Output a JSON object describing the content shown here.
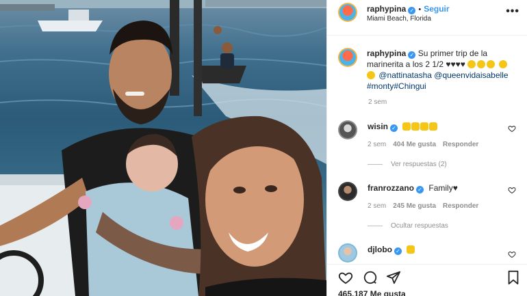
{
  "post": {
    "author": "raphypina",
    "follow_label": "Seguir",
    "location": "Miami Beach, Florida",
    "more_label": "•••"
  },
  "caption": {
    "author": "raphypina",
    "text_1": "Su primer trip de la marinerita a los 2 1/2",
    "hearts": "♥♥♥♥",
    "mention_1": "@nattinatasha",
    "mention_2": "@queenvidaisabelle",
    "hashtag_1": "#monty",
    "hashtag_2": "#Chingui",
    "time": "2 sem"
  },
  "comments": [
    {
      "user": "wisin",
      "time": "2 sem",
      "likes": "404 Me gusta",
      "reply": "Responder",
      "replies_label": "Ver respuestas (2)"
    },
    {
      "user": "franrozzano",
      "text": "Family♥",
      "time": "2 sem",
      "likes": "245 Me gusta",
      "reply": "Responder",
      "replies_label": "Ocultar respuestas"
    },
    {
      "user": "djlobo"
    }
  ],
  "footer": {
    "likes_count": "465.187 Me gusta"
  },
  "icons": {
    "like": "heart-outline-icon",
    "comment": "comment-bubble-icon",
    "share": "paper-plane-icon",
    "save": "bookmark-icon"
  },
  "colors": {
    "accent": "#3897f0",
    "link": "#00376b",
    "muted": "#8e8e8e",
    "text": "#262626"
  }
}
